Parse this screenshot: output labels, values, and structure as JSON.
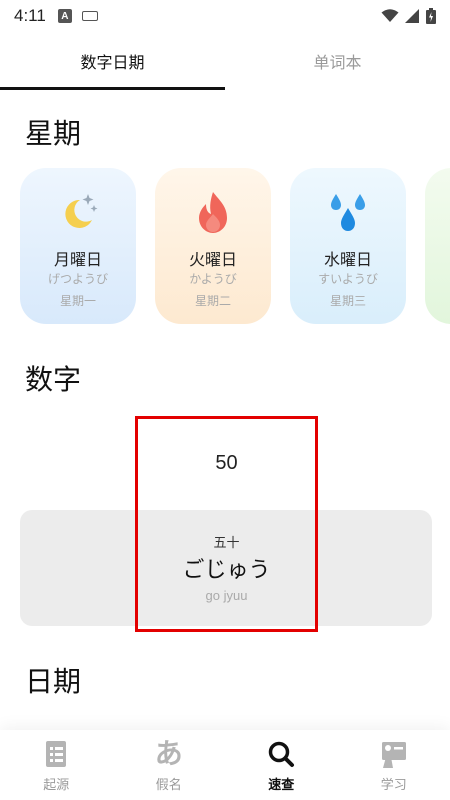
{
  "status": {
    "time": "4:11",
    "a_badge": "A"
  },
  "tabs": [
    {
      "label": "数字日期",
      "active": true
    },
    {
      "label": "单词本",
      "active": false
    }
  ],
  "sections": {
    "weekday": "星期",
    "numbers": "数字",
    "date": "日期"
  },
  "weekdays": [
    {
      "title": "月曜日",
      "kana": "げつようび",
      "cn": "星期一",
      "icon": "moon-stars-icon",
      "bg": "#e6f1fd"
    },
    {
      "title": "火曜日",
      "kana": "かようび",
      "cn": "星期二",
      "icon": "flame-icon",
      "bg": "#fdf0de"
    },
    {
      "title": "水曜日",
      "kana": "すいようび",
      "cn": "星期三",
      "icon": "water-drops-icon",
      "bg": "#e4f3fc"
    }
  ],
  "number": {
    "value": "50",
    "kanji": "五十",
    "kana": "ごじゅう",
    "romaji": "go jyuu"
  },
  "nav": [
    {
      "label": "起源",
      "icon": "list-doc-icon",
      "active": false
    },
    {
      "label": "假名",
      "icon": "kana-a-icon",
      "glyph": "あ",
      "active": false
    },
    {
      "label": "速查",
      "icon": "search-icon",
      "active": true
    },
    {
      "label": "学习",
      "icon": "study-board-icon",
      "active": false
    }
  ],
  "colors": {
    "highlight": "#e30000",
    "active_tab": "#111111",
    "inactive": "#9a9a9a"
  }
}
